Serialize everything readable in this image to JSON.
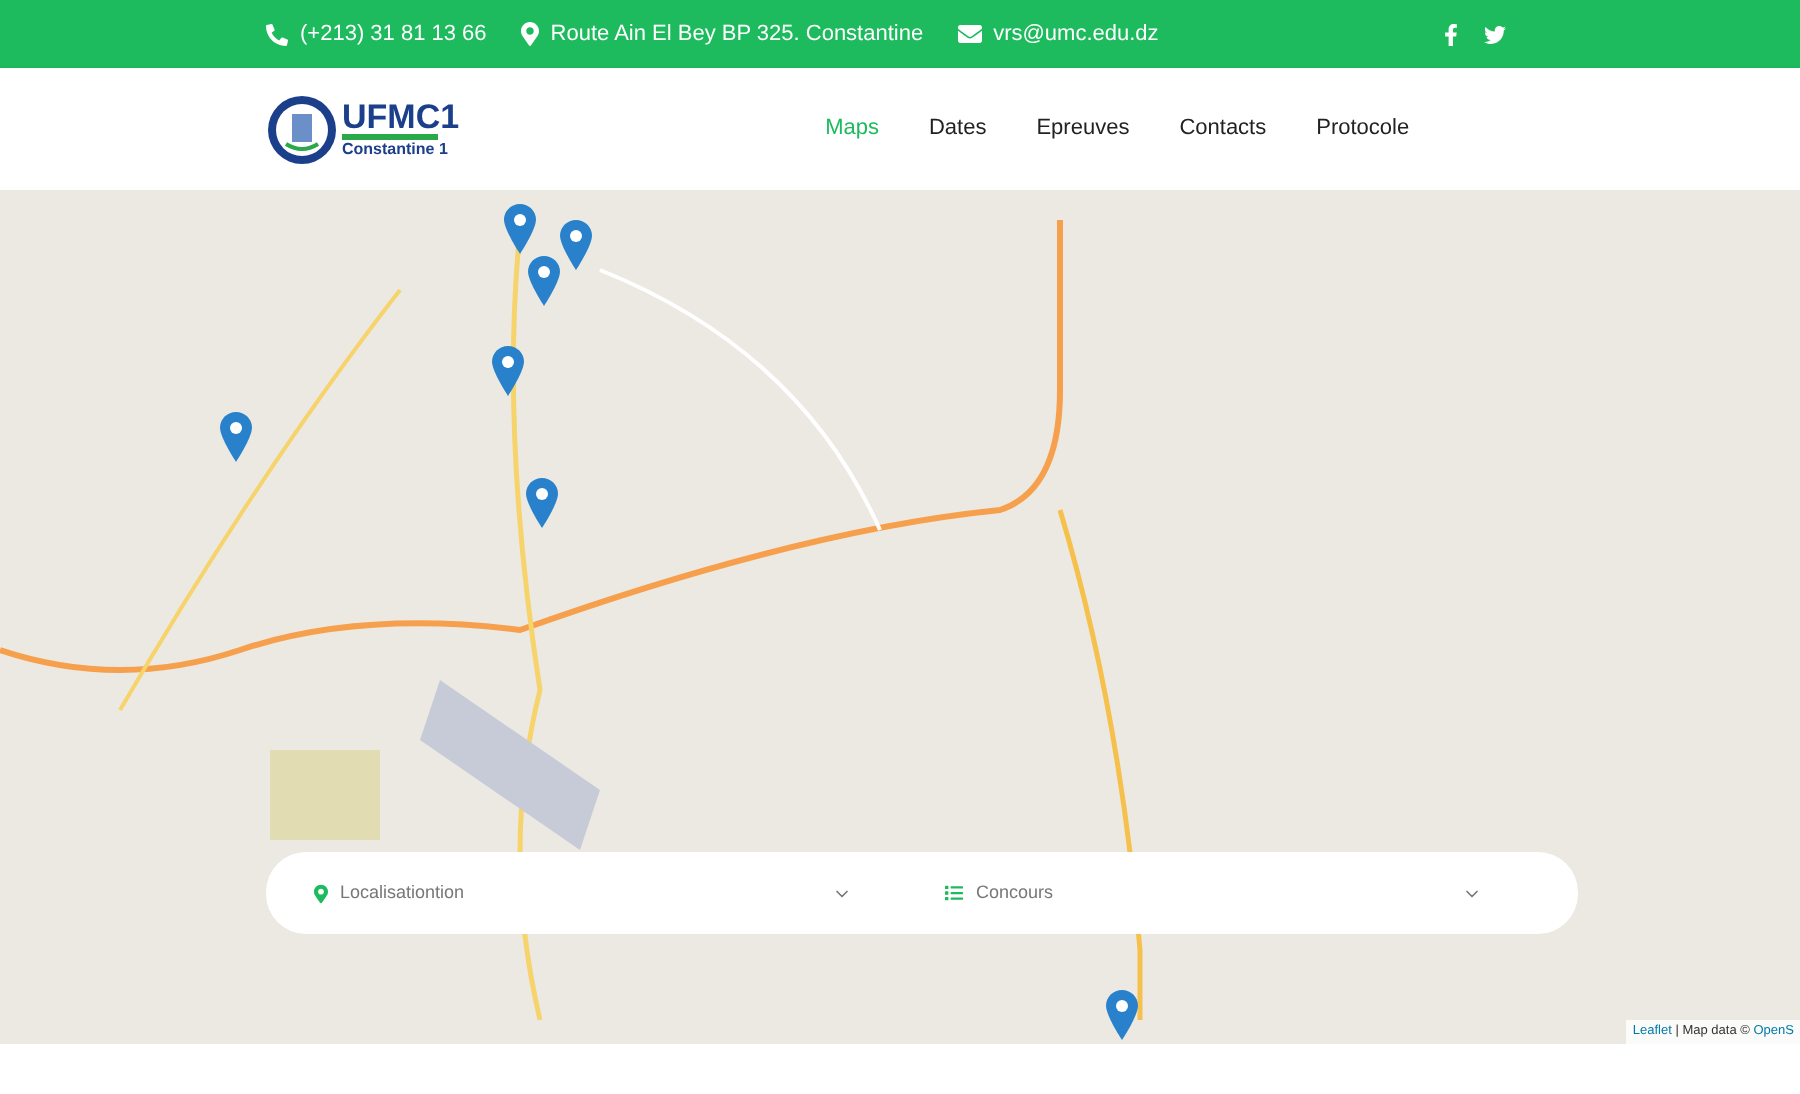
{
  "topbar": {
    "phone": "(+213) 31 81 13 66",
    "address": "Route Ain El Bey BP 325. Constantine",
    "email": "vrs@umc.edu.dz"
  },
  "logo": {
    "title": "UFMC1",
    "subtitle": "Constantine 1"
  },
  "nav": [
    {
      "label": "Maps",
      "selected": true
    },
    {
      "label": "Dates",
      "selected": false
    },
    {
      "label": "Epreuves",
      "selected": false
    },
    {
      "label": "Contacts",
      "selected": false
    },
    {
      "label": "Protocole",
      "selected": false
    }
  ],
  "filters": [
    {
      "kind": "location",
      "value": "Localisationtion"
    },
    {
      "kind": "list",
      "value": "Concours"
    }
  ],
  "attribution": {
    "link": "Leaflet",
    "text": "| Map data ©",
    "link_2": "OpenS"
  }
}
